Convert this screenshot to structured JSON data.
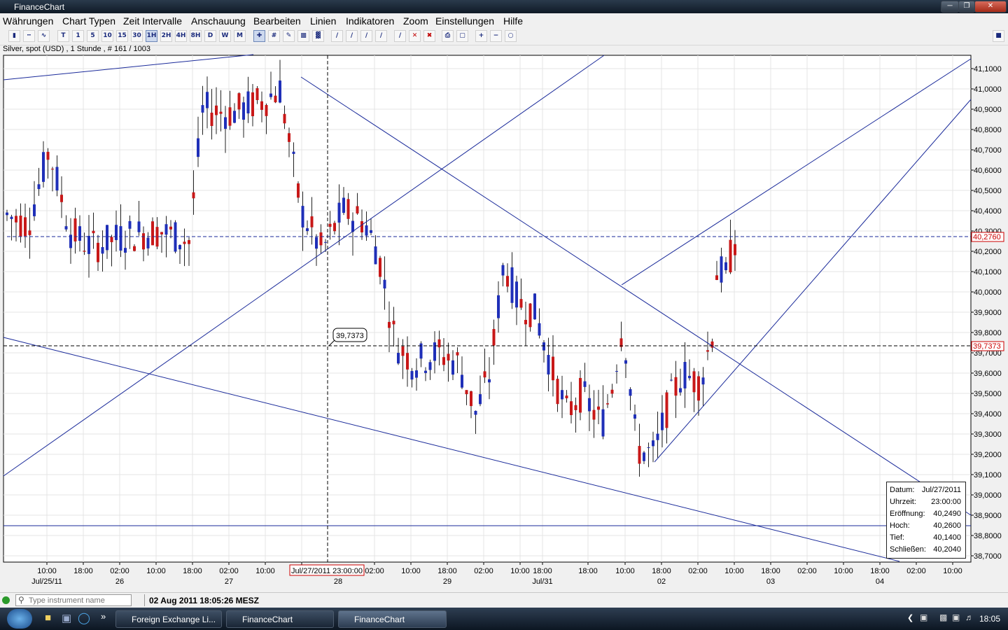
{
  "window": {
    "title": "FinanceChart"
  },
  "menu": [
    "Währungen",
    "Chart Typen",
    "Zeit Intervalle",
    "Anschauung",
    "Bearbeiten",
    "Linien",
    "Indikatoren",
    "Zoom",
    "Einstellungen",
    "Hilfe"
  ],
  "toolbar": {
    "intervals": [
      "T",
      "1",
      "5",
      "10",
      "15",
      "30",
      "1H",
      "2H",
      "4H",
      "8H",
      "D",
      "W",
      "M"
    ],
    "active_interval": "1H"
  },
  "instrument_line": "Silver, spot (USD) , 1 Stunde , # 161 / 1003",
  "chart_data": {
    "type": "candlestick",
    "y_axis": {
      "min": 38.7,
      "max": 41.1,
      "ticks": [
        "41,1000",
        "41,0000",
        "40,9000",
        "40,8000",
        "40,7000",
        "40,6000",
        "40,5000",
        "40,4000",
        "40,3000",
        "40,2000",
        "40,1000",
        "40,0000",
        "39,9000",
        "39,8000",
        "39,7000",
        "39,6000",
        "39,5000",
        "39,4000",
        "39,3000",
        "39,2000",
        "39,1000",
        "39,0000",
        "38,9000",
        "38,8000",
        "38,7000"
      ]
    },
    "x_axis": {
      "ticks": [
        "10:00",
        "18:00",
        "02:00",
        "10:00",
        "18:00",
        "02:00",
        "10:00",
        "18:00",
        "02:00",
        "10:00",
        "18:00",
        "02:00",
        "10:00",
        "18:00",
        "18:00",
        "10:00",
        "18:00",
        "02:00",
        "10:00",
        "18:00",
        "02:00",
        "10:00",
        "18:00",
        "02:00",
        "10:00",
        "18:00"
      ],
      "dates": [
        "Jul/25/11",
        "26",
        "27",
        "28",
        "29",
        "Jul/31",
        "02",
        "03",
        "04"
      ]
    },
    "price_markers": {
      "current": "40,2760",
      "crosshair": "39,7373"
    },
    "crosshair_label_y": "39,7373",
    "crosshair_time": "Jul/27/2011 23:00:00",
    "candle_count": 161
  },
  "ohlc_box": {
    "rows": [
      {
        "k": "Datum:",
        "v": "Jul/27/2011"
      },
      {
        "k": "Uhrzeit:",
        "v": "23:00:00"
      },
      {
        "k": "Eröffnung:",
        "v": "40,2490"
      },
      {
        "k": "Hoch:",
        "v": "40,2600"
      },
      {
        "k": "Tief:",
        "v": "40,1400"
      },
      {
        "k": "Schließen:",
        "v": "40,2040"
      }
    ]
  },
  "status": {
    "search_placeholder": "Type instrument name",
    "timestamp": "02 Aug 2011 18:05:26 MESZ"
  },
  "taskbar": {
    "items": [
      "Foreign Exchange Li...",
      "FinanceChart",
      "FinanceChart"
    ],
    "clock": "18:05"
  }
}
